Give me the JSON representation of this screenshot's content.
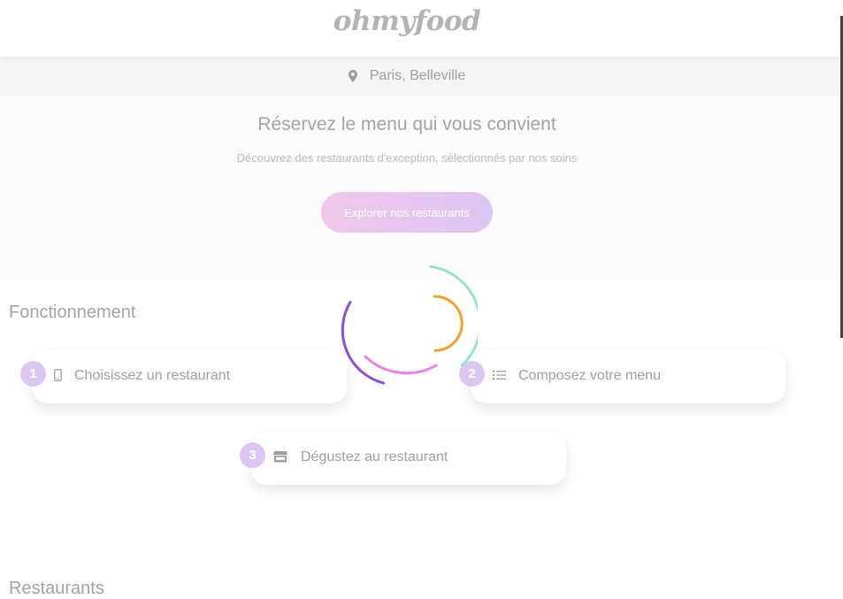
{
  "header": {
    "logo_text": "ohmyfood"
  },
  "location": {
    "icon": "map-pin-icon",
    "text": "Paris, Belleville"
  },
  "hero": {
    "title": "Réservez le menu qui vous convient",
    "subtitle": "Découvrez des restaurants d'exception, sélectionnés par nos soins",
    "cta_label": "Explorer nos restaurants"
  },
  "how_it_works": {
    "title": "Fonctionnement",
    "steps": [
      {
        "number": "1",
        "icon": "mobile-phone-icon",
        "label": "Choisissez un restaurant"
      },
      {
        "number": "2",
        "icon": "list-icon",
        "label": "Composez votre menu"
      },
      {
        "number": "3",
        "icon": "storefront-icon",
        "label": "Dégustez au restaurant"
      }
    ]
  },
  "restaurants": {
    "title": "Restaurants"
  },
  "colors": {
    "accent_pink": "#f2c7ec",
    "accent_purple": "#dcc6f3",
    "text_gray": "#a4a4a4",
    "spinner_purple": "#8a4fd6",
    "spinner_teal": "#99e2cf",
    "spinner_orange": "#f0a12b",
    "spinner_pink": "#ec80e6"
  }
}
